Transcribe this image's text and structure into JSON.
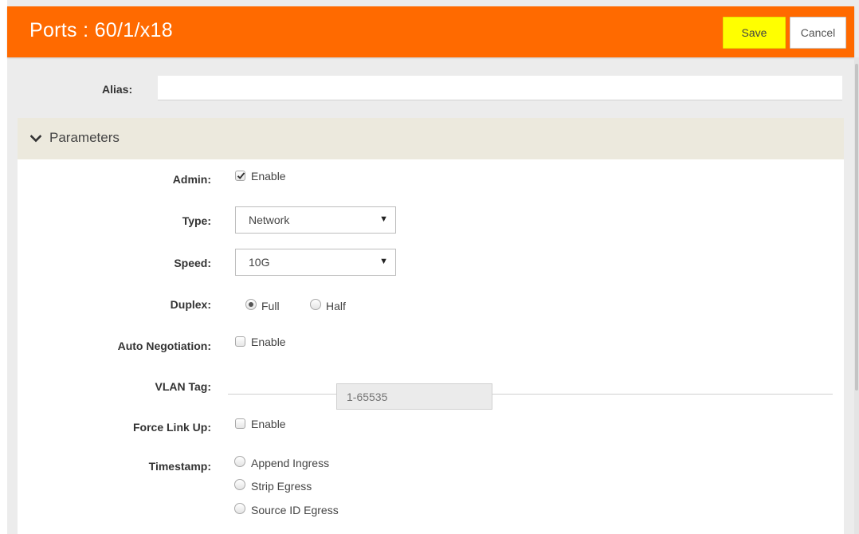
{
  "header": {
    "title": "Ports : 60/1/x18",
    "save_label": "Save",
    "cancel_label": "Cancel",
    "accent_color": "#ff6a00"
  },
  "alias": {
    "label": "Alias:",
    "value": ""
  },
  "parameters": {
    "title": "Parameters",
    "icon": "chevron-down-icon",
    "admin": {
      "label": "Admin:",
      "option_label": "Enable",
      "checked": true
    },
    "type": {
      "label": "Type:",
      "value": "Network"
    },
    "speed": {
      "label": "Speed:",
      "value": "10G"
    },
    "duplex": {
      "label": "Duplex:",
      "options": [
        "Full",
        "Half"
      ],
      "selected": "Full"
    },
    "auto_negotiation": {
      "label": "Auto Negotiation:",
      "option_label": "Enable",
      "checked": false
    },
    "vlan_tag": {
      "label": "VLAN Tag:",
      "value": ""
    },
    "force_link_up": {
      "label": "Force Link Up:",
      "option_label": "Enable",
      "checked": false
    },
    "timestamp": {
      "label": "Timestamp:",
      "options": [
        "Append Ingress",
        "Strip Egress",
        "Source ID Egress"
      ],
      "selected": null,
      "source_id_placeholder": "1-65535"
    }
  }
}
